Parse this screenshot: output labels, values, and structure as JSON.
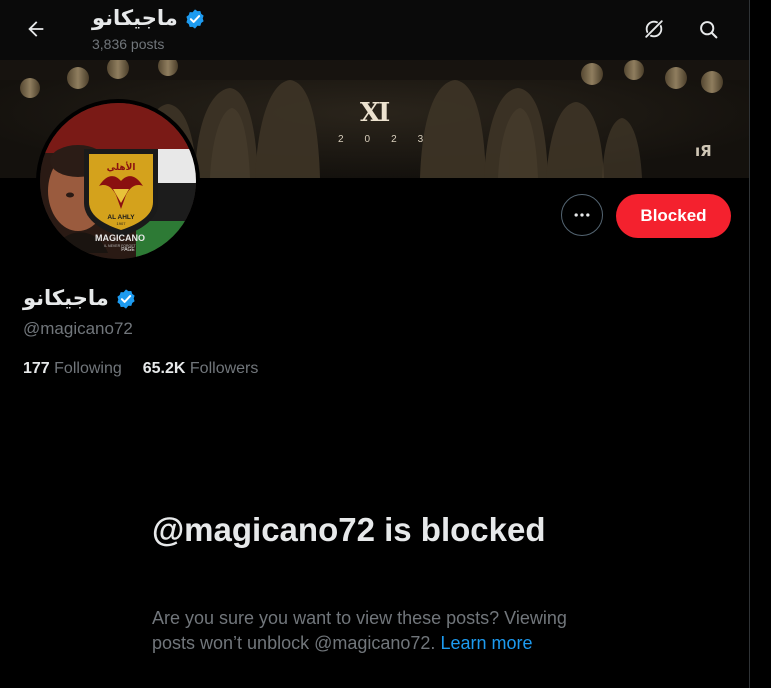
{
  "header": {
    "name": "ماجيكانو",
    "posts_count": "3,836 posts"
  },
  "banner": {
    "emblem": "XI",
    "year": "2023",
    "mark": "ıЯ"
  },
  "avatar": {
    "logo_text": "الأهلي",
    "club": "AL AHLY",
    "founded": "1907",
    "page_name": "MAGICANO",
    "tagline": "IL NEVER FORGET",
    "page_label": "PAGE"
  },
  "actions": {
    "blocked_label": "Blocked"
  },
  "profile": {
    "name": "ماجيكانو",
    "handle": "@magicano72",
    "following_count": "177",
    "following_label": "Following",
    "followers_count": "65.2K",
    "followers_label": "Followers"
  },
  "blocked_notice": {
    "title": "@magicano72 is blocked",
    "body": "Are you sure you want to view these posts? Viewing posts won’t unblock @magicano72.",
    "link": "Learn more"
  },
  "colors": {
    "accent": "#1d9bf0",
    "blocked": "#f4212e",
    "verified": "#1d9bf0"
  }
}
